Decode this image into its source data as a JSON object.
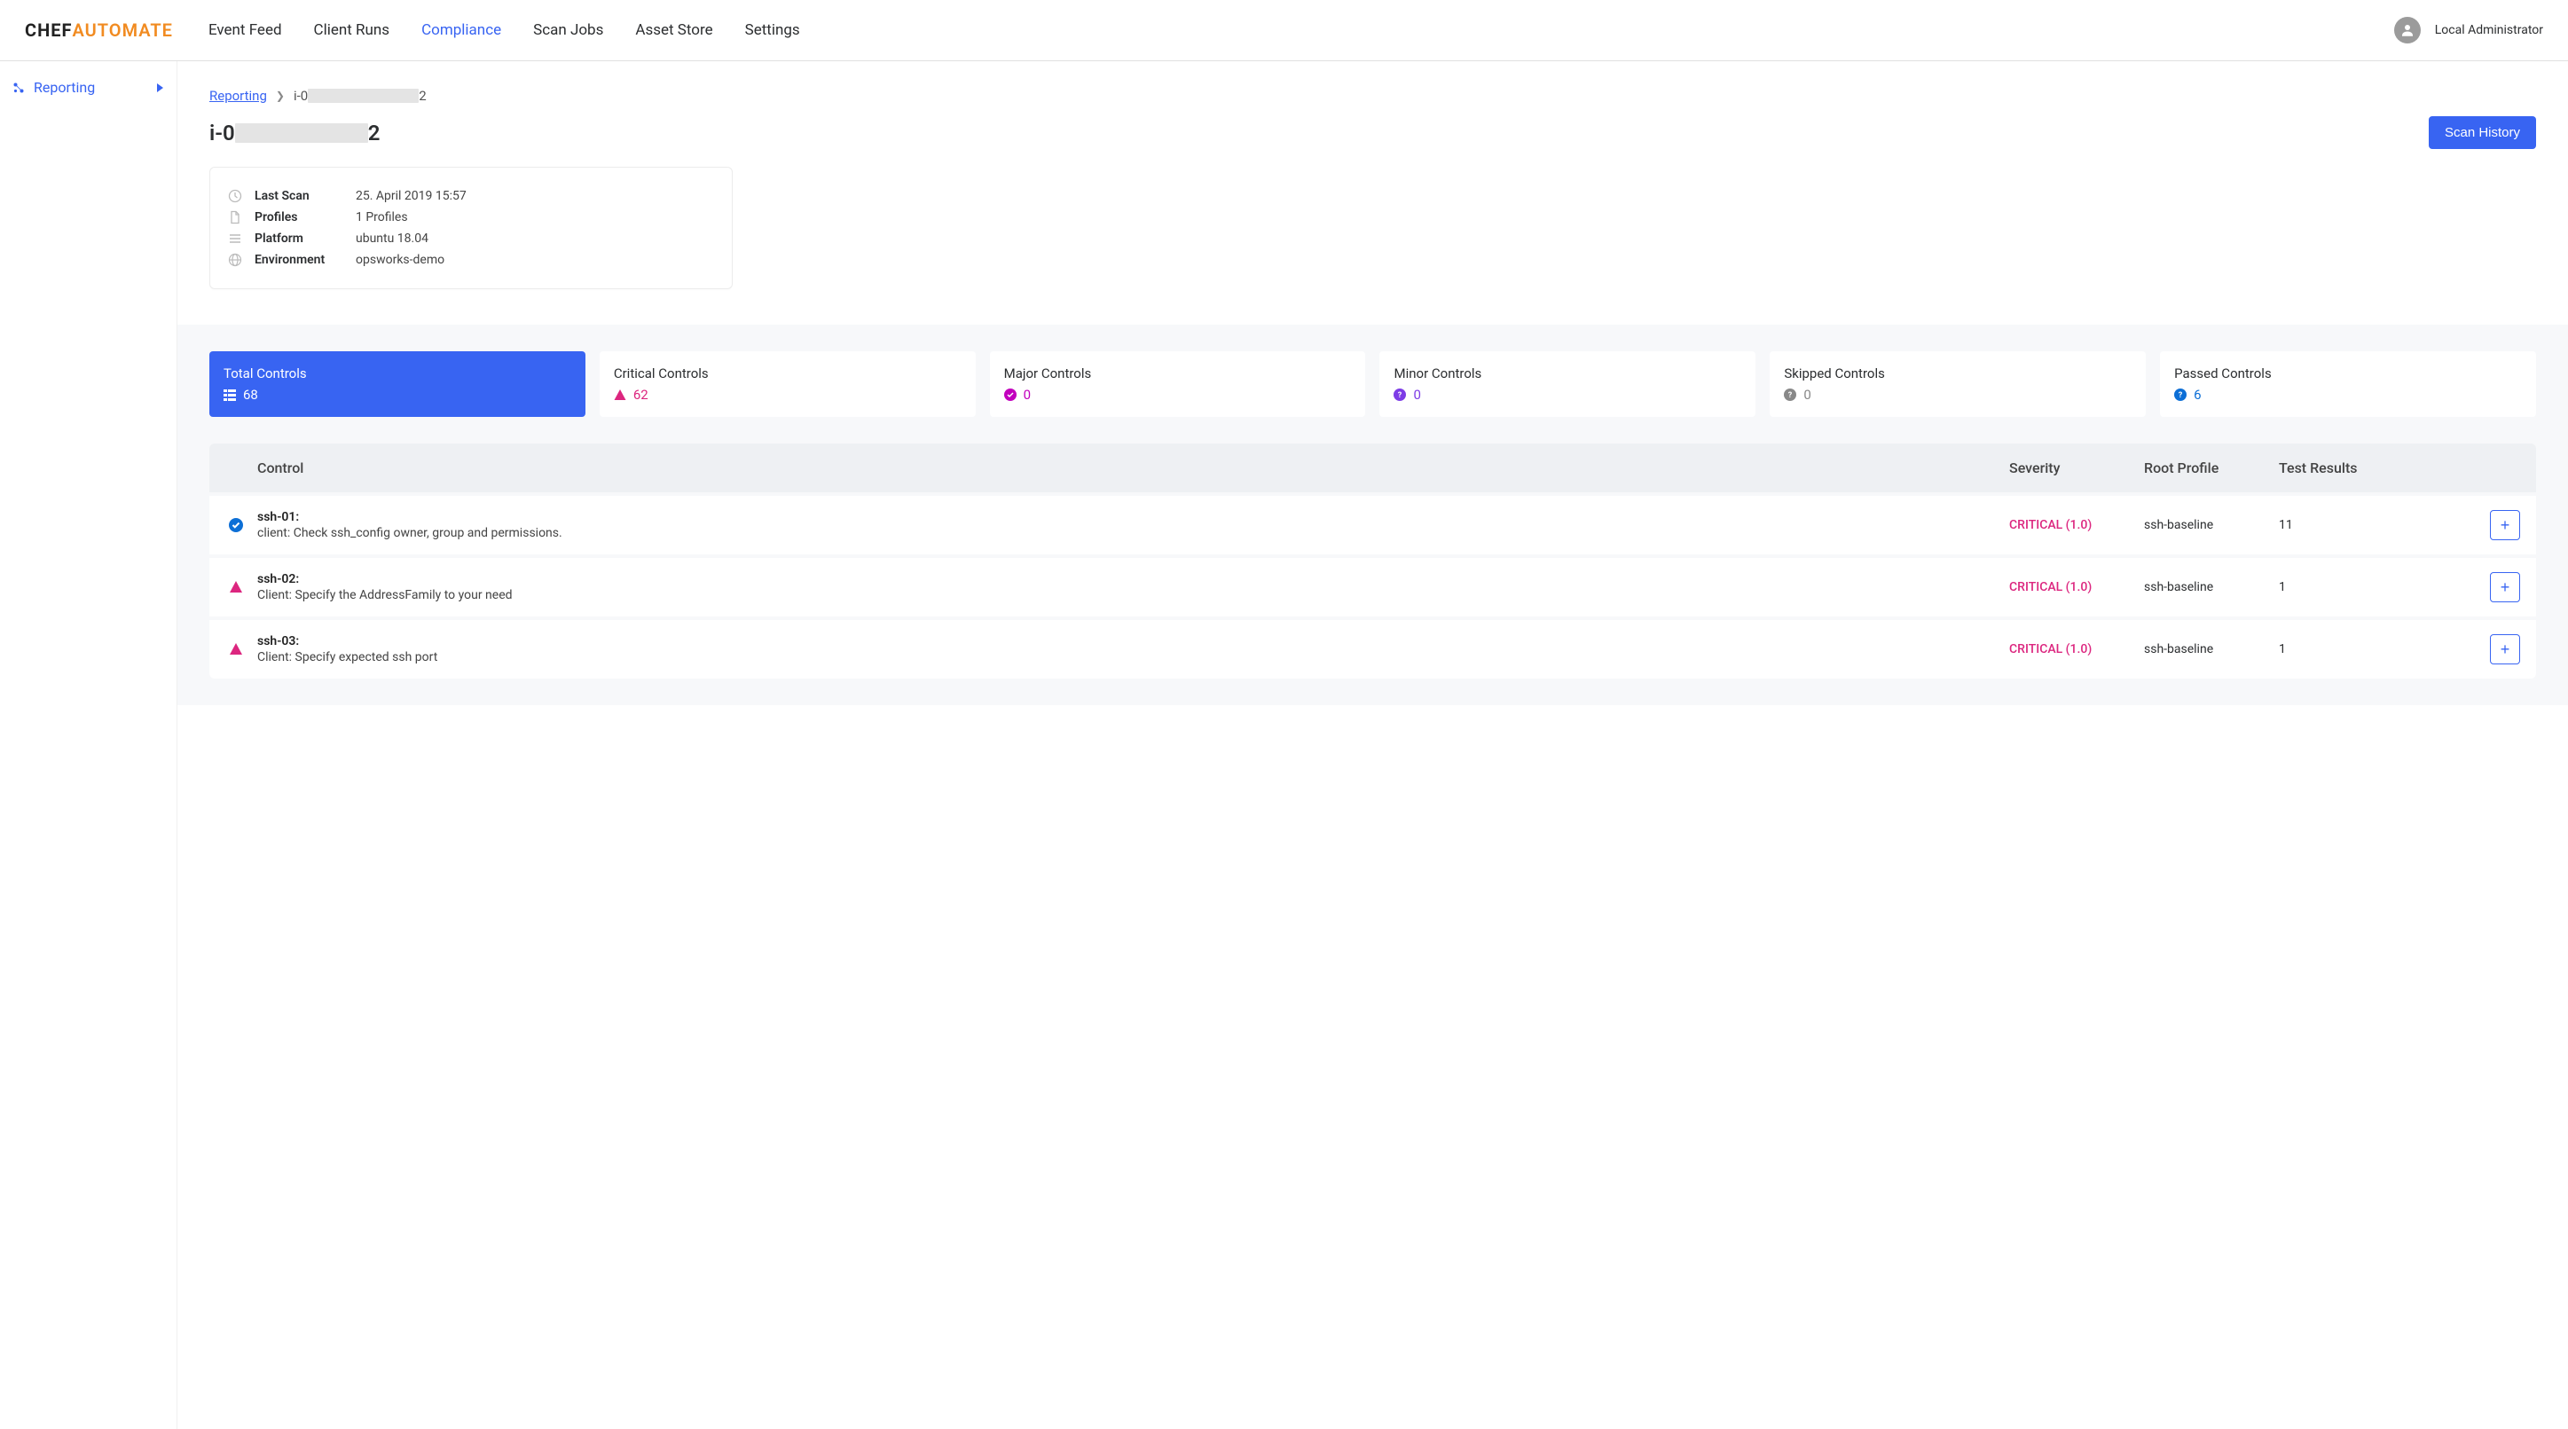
{
  "logo": {
    "part1": "CHEF",
    "part2": "AUTOMATE"
  },
  "topNav": {
    "items": [
      {
        "label": "Event Feed",
        "active": false
      },
      {
        "label": "Client Runs",
        "active": false
      },
      {
        "label": "Compliance",
        "active": true
      },
      {
        "label": "Scan Jobs",
        "active": false
      },
      {
        "label": "Asset Store",
        "active": false
      },
      {
        "label": "Settings",
        "active": false
      }
    ]
  },
  "user": {
    "name": "Local Administrator"
  },
  "sidebar": {
    "label": "Reporting"
  },
  "breadcrumb": {
    "link": "Reporting",
    "currentPrefix": "i-0",
    "currentSuffix": "2"
  },
  "titlePrefix": "i-0",
  "titleSuffix": "2",
  "scanHistoryLabel": "Scan History",
  "info": {
    "rows": [
      {
        "icon": "clock",
        "label": "Last Scan",
        "value": "25. April 2019 15:57"
      },
      {
        "icon": "file",
        "label": "Profiles",
        "value": "1 Profiles"
      },
      {
        "icon": "list",
        "label": "Platform",
        "value": "ubuntu 18.04"
      },
      {
        "icon": "globe",
        "label": "Environment",
        "value": "opsworks-demo"
      }
    ]
  },
  "filters": [
    {
      "title": "Total Controls",
      "count": "68",
      "icon": "list",
      "active": true,
      "colorClass": "fc-active"
    },
    {
      "title": "Critical Controls",
      "count": "62",
      "icon": "triangle",
      "active": false,
      "colorClass": "fc-critical"
    },
    {
      "title": "Major Controls",
      "count": "0",
      "icon": "circle-check",
      "active": false,
      "colorClass": "fc-major"
    },
    {
      "title": "Minor Controls",
      "count": "0",
      "icon": "circle-q",
      "active": false,
      "colorClass": "fc-minor"
    },
    {
      "title": "Skipped Controls",
      "count": "0",
      "icon": "circle-q",
      "active": false,
      "colorClass": "fc-skipped"
    },
    {
      "title": "Passed Controls",
      "count": "6",
      "icon": "circle-q",
      "active": false,
      "colorClass": "fc-passed"
    }
  ],
  "table": {
    "headers": {
      "control": "Control",
      "severity": "Severity",
      "profile": "Root Profile",
      "results": "Test Results"
    },
    "rows": [
      {
        "status": "pass",
        "id": "ssh-01:",
        "desc": "client: Check ssh_config owner, group and permissions.",
        "severity": "CRITICAL (1.0)",
        "profile": "ssh-baseline",
        "results": "11"
      },
      {
        "status": "fail",
        "id": "ssh-02:",
        "desc": "Client: Specify the AddressFamily to your need",
        "severity": "CRITICAL (1.0)",
        "profile": "ssh-baseline",
        "results": "1"
      },
      {
        "status": "fail",
        "id": "ssh-03:",
        "desc": "Client: Specify expected ssh port",
        "severity": "CRITICAL (1.0)",
        "profile": "ssh-baseline",
        "results": "1"
      }
    ]
  }
}
